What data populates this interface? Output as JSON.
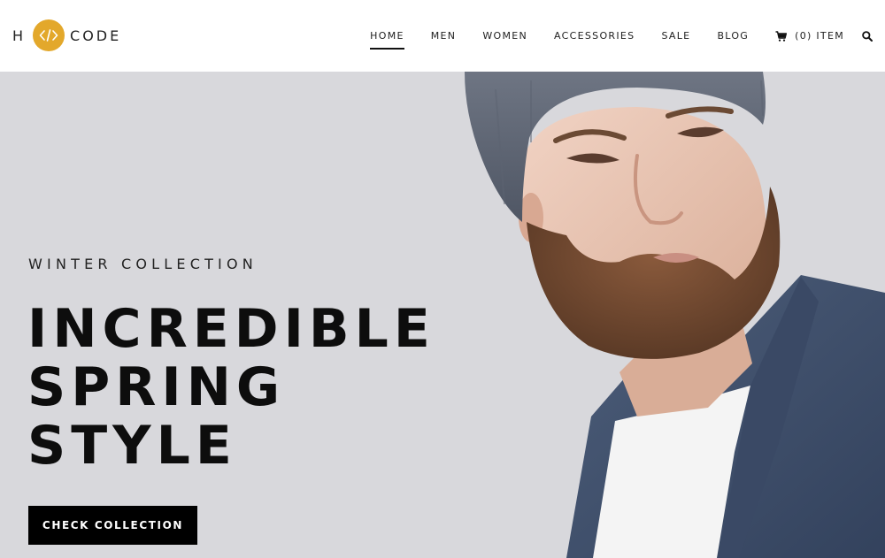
{
  "logo": {
    "left_letter": "H",
    "right_text": "CODE",
    "icon": "code-brackets-icon",
    "badge_color": "#e3a82b"
  },
  "nav": {
    "items": [
      {
        "label": "HOME",
        "active": true
      },
      {
        "label": "MEN",
        "active": false
      },
      {
        "label": "WOMEN",
        "active": false
      },
      {
        "label": "ACCESSORIES",
        "active": false
      },
      {
        "label": "SALE",
        "active": false
      },
      {
        "label": "BLOG",
        "active": false
      }
    ],
    "cart_label": "(0) ITEM",
    "cart_icon": "cart-icon",
    "search_icon": "search-icon"
  },
  "hero": {
    "eyebrow": "WINTER COLLECTION",
    "headline": [
      "INCREDIBLE",
      "SPRING",
      "STYLE"
    ],
    "cta_label": "CHECK COLLECTION",
    "background": "#d8d8dc",
    "image": "man-with-beanie-and-beard-photo"
  }
}
